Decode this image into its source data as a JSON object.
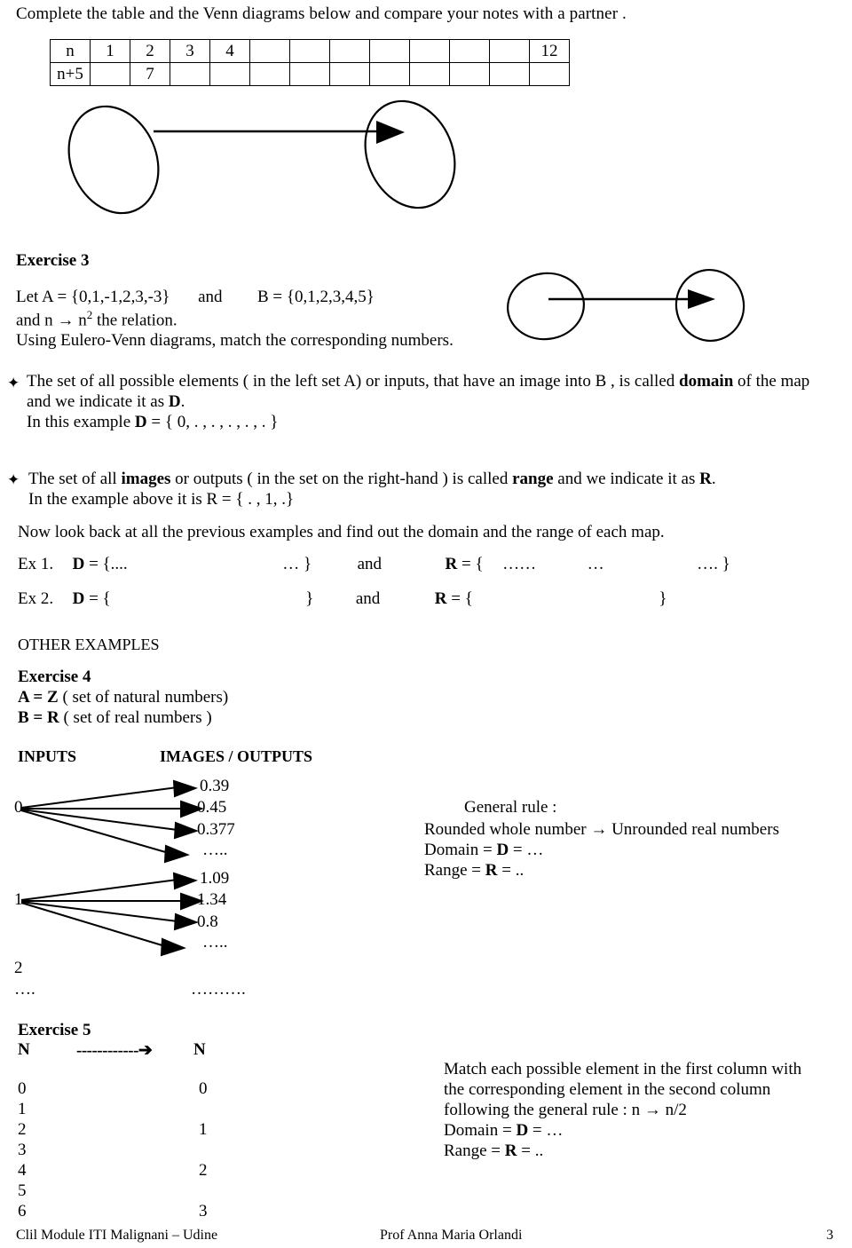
{
  "intro": {
    "text": "Complete the table and the Venn diagrams below and compare your notes with a partner ."
  },
  "table": {
    "rows": [
      {
        "label": "n",
        "cells": [
          "1",
          "2",
          "3",
          "4",
          "",
          "",
          "",
          "",
          "",
          "",
          "",
          "12"
        ]
      },
      {
        "label": "n+5",
        "cells": [
          "",
          "7",
          "",
          "",
          "",
          "",
          "",
          "",
          "",
          "",
          "",
          ""
        ]
      }
    ]
  },
  "venn_top": {
    "arrow_icon": "arrow-right-icon",
    "left_set_label": "",
    "right_set_label": ""
  },
  "exercise3": {
    "heading": "Exercise 3",
    "line1_a": "Let  A = {0,1,-1,2,3,-3}",
    "line1_b": "and",
    "line1_c": "B = {0,1,2,3,4,5}",
    "line2_pre": "and   n ",
    "line2_arrow": "→",
    "line2_mid": " n",
    "line2_sup": "2",
    "line2_post": "  the relation.",
    "line3": "Using Eulero-Venn  diagrams, match the corresponding numbers."
  },
  "bullet1": {
    "glyph": "✦",
    "glyph_name": "four-pointed-star-bullet-icon",
    "seg1": "The set of all possible elements ( in the left set A) or inputs, that have an image into B , is called ",
    "bold1": "domain",
    "seg2": " of the map",
    "line2_pre": "and we indicate it as ",
    "line2_bold": "D",
    "line2_post": ".",
    "line3_pre": "In this example ",
    "line3_bold": "D",
    "line3_post": " = { 0, . , . , . , . , . }"
  },
  "bullet2": {
    "glyph": "✦",
    "glyph_name": "four-pointed-star-bullet-icon",
    "seg1": "The set of all ",
    "bold1": "images",
    "seg2": " or outputs ( in the set on the right-hand ) is called ",
    "bold2": "range",
    "seg3": " and we indicate it as ",
    "bold3": "R",
    "seg4": ".",
    "line2": "In the example above it is R = { . , 1, .}"
  },
  "nowlook": {
    "text": "Now look back at all the previous examples and find out the domain and the range of each map."
  },
  "ex1": {
    "label": "Ex 1.",
    "d_bold": "D",
    "d_open": " = {....",
    "d_dots": "… }",
    "and": "and",
    "r_bold": "R",
    "r_open": " = {",
    "r_dots1": "……",
    "r_dots2": "…",
    "r_dots3": "…. }"
  },
  "ex2": {
    "label": "Ex 2.",
    "d_bold": "D",
    "d_open": " = {",
    "d_close": "}",
    "and": "and",
    "r_bold": "R",
    "r_open": " = {",
    "r_close": "}"
  },
  "other_examples": {
    "heading": "OTHER EXAMPLES"
  },
  "exercise4": {
    "heading": "Exercise 4",
    "line_a_bold": "A = Z",
    "line_a_rest": " ( set of natural numbers)",
    "line_b_bold": "B = R",
    "line_b_rest": "  ( set of real numbers )",
    "col_inputs": "INPUTS",
    "col_outputs": "IMAGES / OUTPUTS",
    "inputs": [
      "0",
      "1",
      "2",
      "…."
    ],
    "outputs_group1": [
      "0.39",
      "0.45",
      "0.377",
      "….."
    ],
    "outputs_group2": [
      "1.09",
      "1.34",
      "0.8",
      "….."
    ],
    "outputs_tail": "……….",
    "rule_title": "General rule :",
    "rule_line_pre": "Rounded whole number ",
    "rule_line_arrow": "→",
    "rule_line_post": " Unrounded real numbers",
    "domain_pre": "Domain = ",
    "domain_bold": "D",
    "domain_post": " = …",
    "range_pre": "Range = ",
    "range_bold": "R",
    "range_post": " = .."
  },
  "exercise5": {
    "heading": "Exercise 5",
    "left_set": "N",
    "arrow_dashes": "------------➔",
    "right_set": "N",
    "left_column": [
      "0",
      "1",
      "2",
      "3",
      "4",
      "5",
      "6"
    ],
    "right_column": [
      "0",
      "",
      "1",
      "",
      "2",
      "",
      "3"
    ],
    "instr_line1": "Match each possible element in the first column with",
    "instr_line2": "the corresponding element in the second column",
    "instr_line3_pre": "following the general rule : n ",
    "instr_line3_arrow": "→",
    "instr_line3_post": " n/2",
    "domain_pre": "Domain = ",
    "domain_bold": "D",
    "domain_post": " = …",
    "range_pre": "Range = ",
    "range_bold": "R",
    "range_post": " = .."
  },
  "footer": {
    "left": "Clil  Module   ITI  Malignani – Udine",
    "center": "Prof Anna Maria Orlandi",
    "page": "3"
  },
  "colors": {
    "ink": "#000000",
    "paper": "#ffffff"
  }
}
